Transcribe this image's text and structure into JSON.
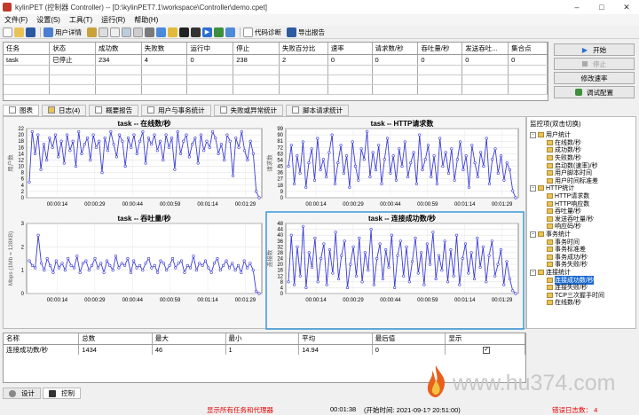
{
  "window": {
    "title": "kylinPET (控制器 Controller) -- [D:\\kylinPET7.1\\workspace\\Controller\\demo.cpet]",
    "controls": [
      "–",
      "□",
      "✕"
    ]
  },
  "menu": [
    "文件(F)",
    "设置(S)",
    "工具(T)",
    "运行(R)",
    "帮助(H)"
  ],
  "toolbar": {
    "user_details": "用户详情",
    "code_diag": "代码诊断",
    "export_report": "导出报告"
  },
  "task_table": {
    "headers": [
      "任务",
      "状态",
      "成功数",
      "失败数",
      "运行中",
      "停止",
      "失败百分比",
      "速率",
      "请求数/秒",
      "吞吐量/秒",
      "发送吞吐...",
      "集合点"
    ],
    "rows": [
      [
        "task",
        "已停止",
        "234",
        "4",
        "0",
        "238",
        "2",
        "0",
        "0",
        "0",
        "0",
        "0"
      ]
    ]
  },
  "control_buttons": {
    "start": "开始",
    "stop": "停止",
    "change_rate": "修改速率",
    "debug_config": "调试配置"
  },
  "tabs": [
    "图表",
    "日志(4)",
    "概要报告",
    "用户与事务统计",
    "失败或异常统计",
    "脚本请求统计"
  ],
  "monitor": {
    "title": "监控项(双击切换)",
    "groups": [
      {
        "label": "用户统计",
        "items": [
          "在线数/秒",
          "成功数/秒",
          "失败数/秒",
          "启动数(速率)/秒",
          "用户脚本时间",
          "用户时间标准差"
        ]
      },
      {
        "label": "HTTP统计",
        "items": [
          "HTTP请求数",
          "HTTP响应数",
          "吞吐量/秒",
          "发送吞吐量/秒",
          "响应码/秒"
        ]
      },
      {
        "label": "事务统计",
        "items": [
          "事务时间",
          "事务标准差",
          "事务成功/秒",
          "事务失败/秒"
        ]
      },
      {
        "label": "连接统计",
        "items": [
          "连接成功数/秒",
          "连接失败/秒",
          "TCP三次握手时间",
          "在线数/秒"
        ]
      }
    ],
    "selected": "连接成功数/秒"
  },
  "stat_table": {
    "headers": [
      "名称",
      "总数",
      "最大",
      "最小",
      "平均",
      "最后值",
      "显示"
    ],
    "rows": [
      [
        "连接成功数/秒",
        "1434",
        "46",
        "1",
        "14.94",
        "0",
        ""
      ]
    ]
  },
  "bottom_tabs": [
    "设计",
    "控制"
  ],
  "status": {
    "message": "显示所有任务和代理器",
    "elapsed": "00:01:38",
    "start_time": "(开始时间: 2021-09-1? 20:51:00)",
    "error_log": "错误日志数： 4"
  },
  "watermark": "www.hu374.com",
  "colors": {
    "series": "#3b3bd9",
    "selected_border": "#3a9ad9",
    "status_red": "#e60000"
  },
  "chart_data": [
    {
      "type": "line",
      "title": "task -- 在线数/秒",
      "ylabel": "用户数",
      "ylim": [
        0,
        22
      ],
      "yticks": [
        0,
        2,
        4,
        6,
        8,
        10,
        12,
        14,
        16,
        18,
        20,
        22
      ],
      "xticks": [
        "00:00:14",
        "00:00:29",
        "00:00:44",
        "00:00:59",
        "00:01:14",
        "00:01:29"
      ],
      "series": [
        {
          "values": [
            5,
            21,
            14,
            20,
            9,
            17,
            12,
            19,
            16,
            20,
            13,
            18,
            11,
            20,
            15,
            18,
            10,
            21,
            14,
            17,
            19,
            12,
            20,
            16,
            18,
            8,
            19,
            15,
            21,
            17,
            13,
            20,
            18,
            10,
            19,
            16,
            20,
            14,
            18,
            21,
            11,
            19,
            17,
            20,
            15,
            18,
            12,
            20,
            16,
            19,
            9,
            21,
            14,
            18,
            20,
            13,
            17,
            19,
            11,
            20,
            15,
            18,
            16,
            21,
            19,
            14,
            17,
            12,
            20,
            18,
            7,
            19,
            16,
            21,
            15,
            12,
            18,
            14,
            2,
            0
          ]
        }
      ]
    },
    {
      "type": "line",
      "title": "task -- HTTP请求数",
      "ylabel": "请求数",
      "ylim": [
        0,
        99
      ],
      "yticks": [
        0,
        9,
        18,
        27,
        36,
        45,
        54,
        63,
        72,
        81,
        90,
        99
      ],
      "xticks": [
        "00:00:14",
        "00:00:29",
        "00:00:44",
        "00:00:59",
        "00:01:14",
        "00:01:29"
      ],
      "series": [
        {
          "values": [
            45,
            75,
            20,
            60,
            35,
            80,
            15,
            50,
            70,
            25,
            85,
            40,
            55,
            30,
            65,
            90,
            20,
            50,
            75,
            35,
            60,
            15,
            80,
            45,
            25,
            70,
            55,
            95,
            30,
            65,
            40,
            75,
            20,
            55,
            85,
            35,
            60,
            25,
            70,
            45,
            80,
            30,
            50,
            65,
            20,
            90,
            40,
            55,
            75,
            30,
            60,
            20,
            85,
            45,
            65,
            35,
            70,
            25,
            55,
            80,
            40,
            60,
            15,
            75,
            50,
            30,
            65,
            45,
            85,
            20,
            55,
            70,
            35,
            60,
            25,
            50,
            40,
            10,
            0
          ]
        }
      ]
    },
    {
      "type": "line",
      "title": "task -- 吞吐量/秒",
      "ylabel": "Mbps (1Mb = 128KB)",
      "ylim": [
        0,
        3
      ],
      "yticks": [
        0,
        1,
        2,
        3
      ],
      "xticks": [
        "00:00:14",
        "00:00:29",
        "00:00:44",
        "00:00:59",
        "00:01:14",
        "00:01:29"
      ],
      "series": [
        {
          "values": [
            1.4,
            1.2,
            1.1,
            2.5,
            1.3,
            1.0,
            1.5,
            1.2,
            0.9,
            1.4,
            1.1,
            1.3,
            1.0,
            1.5,
            1.2,
            1.1,
            1.6,
            0.9,
            1.3,
            1.4,
            1.0,
            1.2,
            1.5,
            1.1,
            1.3,
            0.9,
            1.4,
            1.2,
            1.0,
            1.6,
            1.1,
            1.3,
            1.2,
            1.5,
            0.9,
            1.4,
            1.1,
            1.2,
            1.0,
            1.3,
            1.5,
            1.1,
            1.2,
            0.9,
            1.4,
            1.3,
            1.0,
            1.2,
            1.5,
            1.1,
            1.3,
            1.4,
            0.9,
            1.2,
            1.1,
            1.6,
            1.0,
            1.3,
            1.2,
            1.4,
            1.1,
            0.9,
            1.3,
            1.5,
            1.0,
            1.2,
            1.4,
            1.1,
            1.3,
            1.0,
            1.2,
            0.9,
            1.4,
            1.1,
            1.3,
            1.0,
            0.1,
            0.0
          ]
        }
      ]
    },
    {
      "type": "line",
      "title": "task -- 连接成功数/秒",
      "ylabel": "连接数",
      "ylim": [
        0,
        48
      ],
      "yticks": [
        0,
        4,
        8,
        12,
        16,
        20,
        24,
        28,
        32,
        36,
        40,
        44,
        48
      ],
      "xticks": [
        "00:00:14",
        "00:00:29",
        "00:00:44",
        "00:00:59",
        "00:01:14",
        "00:01:29"
      ],
      "series": [
        {
          "values": [
            8,
            40,
            6,
            32,
            12,
            46,
            4,
            28,
            18,
            38,
            8,
            24,
            34,
            6,
            30,
            14,
            42,
            10,
            26,
            36,
            4,
            20,
            32,
            12,
            38,
            8,
            28,
            16,
            44,
            6,
            24,
            34,
            10,
            30,
            18,
            40,
            4,
            26,
            36,
            12,
            32,
            8,
            22,
            38,
            14,
            28,
            6,
            34,
            20,
            42,
            10,
            26,
            16,
            36,
            8,
            30,
            12,
            40,
            6,
            24,
            34,
            14,
            28,
            10,
            38,
            18,
            32,
            8,
            26,
            36,
            12,
            20,
            30,
            6,
            22,
            10,
            2,
            0
          ]
        }
      ]
    }
  ]
}
